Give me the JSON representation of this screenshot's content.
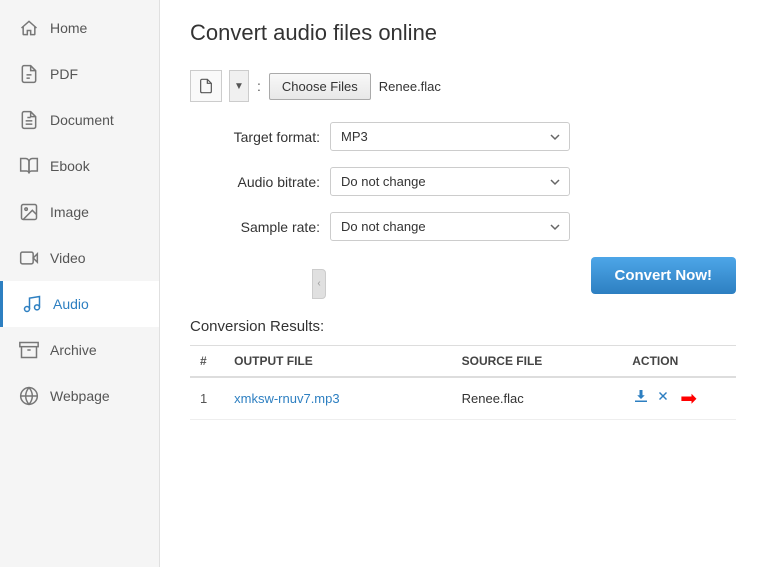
{
  "page": {
    "title": "Convert audio files online"
  },
  "sidebar": {
    "items": [
      {
        "id": "home",
        "label": "Home",
        "active": false
      },
      {
        "id": "pdf",
        "label": "PDF",
        "active": false
      },
      {
        "id": "document",
        "label": "Document",
        "active": false
      },
      {
        "id": "ebook",
        "label": "Ebook",
        "active": false
      },
      {
        "id": "image",
        "label": "Image",
        "active": false
      },
      {
        "id": "video",
        "label": "Video",
        "active": false
      },
      {
        "id": "audio",
        "label": "Audio",
        "active": true
      },
      {
        "id": "archive",
        "label": "Archive",
        "active": false
      },
      {
        "id": "webpage",
        "label": "Webpage",
        "active": false
      }
    ]
  },
  "file_upload": {
    "choose_files_label": "Choose Files",
    "file_name": "Renee.flac"
  },
  "form": {
    "target_format_label": "Target format:",
    "target_format_value": "MP3",
    "audio_bitrate_label": "Audio bitrate:",
    "audio_bitrate_value": "Do not change",
    "sample_rate_label": "Sample rate:",
    "sample_rate_value": "Do not change"
  },
  "convert_button": "Convert Now!",
  "results": {
    "title": "Conversion Results:",
    "headers": {
      "num": "#",
      "output_file": "OUTPUT FILE",
      "source_file": "SOURCE FILE",
      "action": "ACTION"
    },
    "rows": [
      {
        "num": "1",
        "output_file": "xmksw-rnuv7.mp3",
        "source_file": "Renee.flac"
      }
    ]
  }
}
